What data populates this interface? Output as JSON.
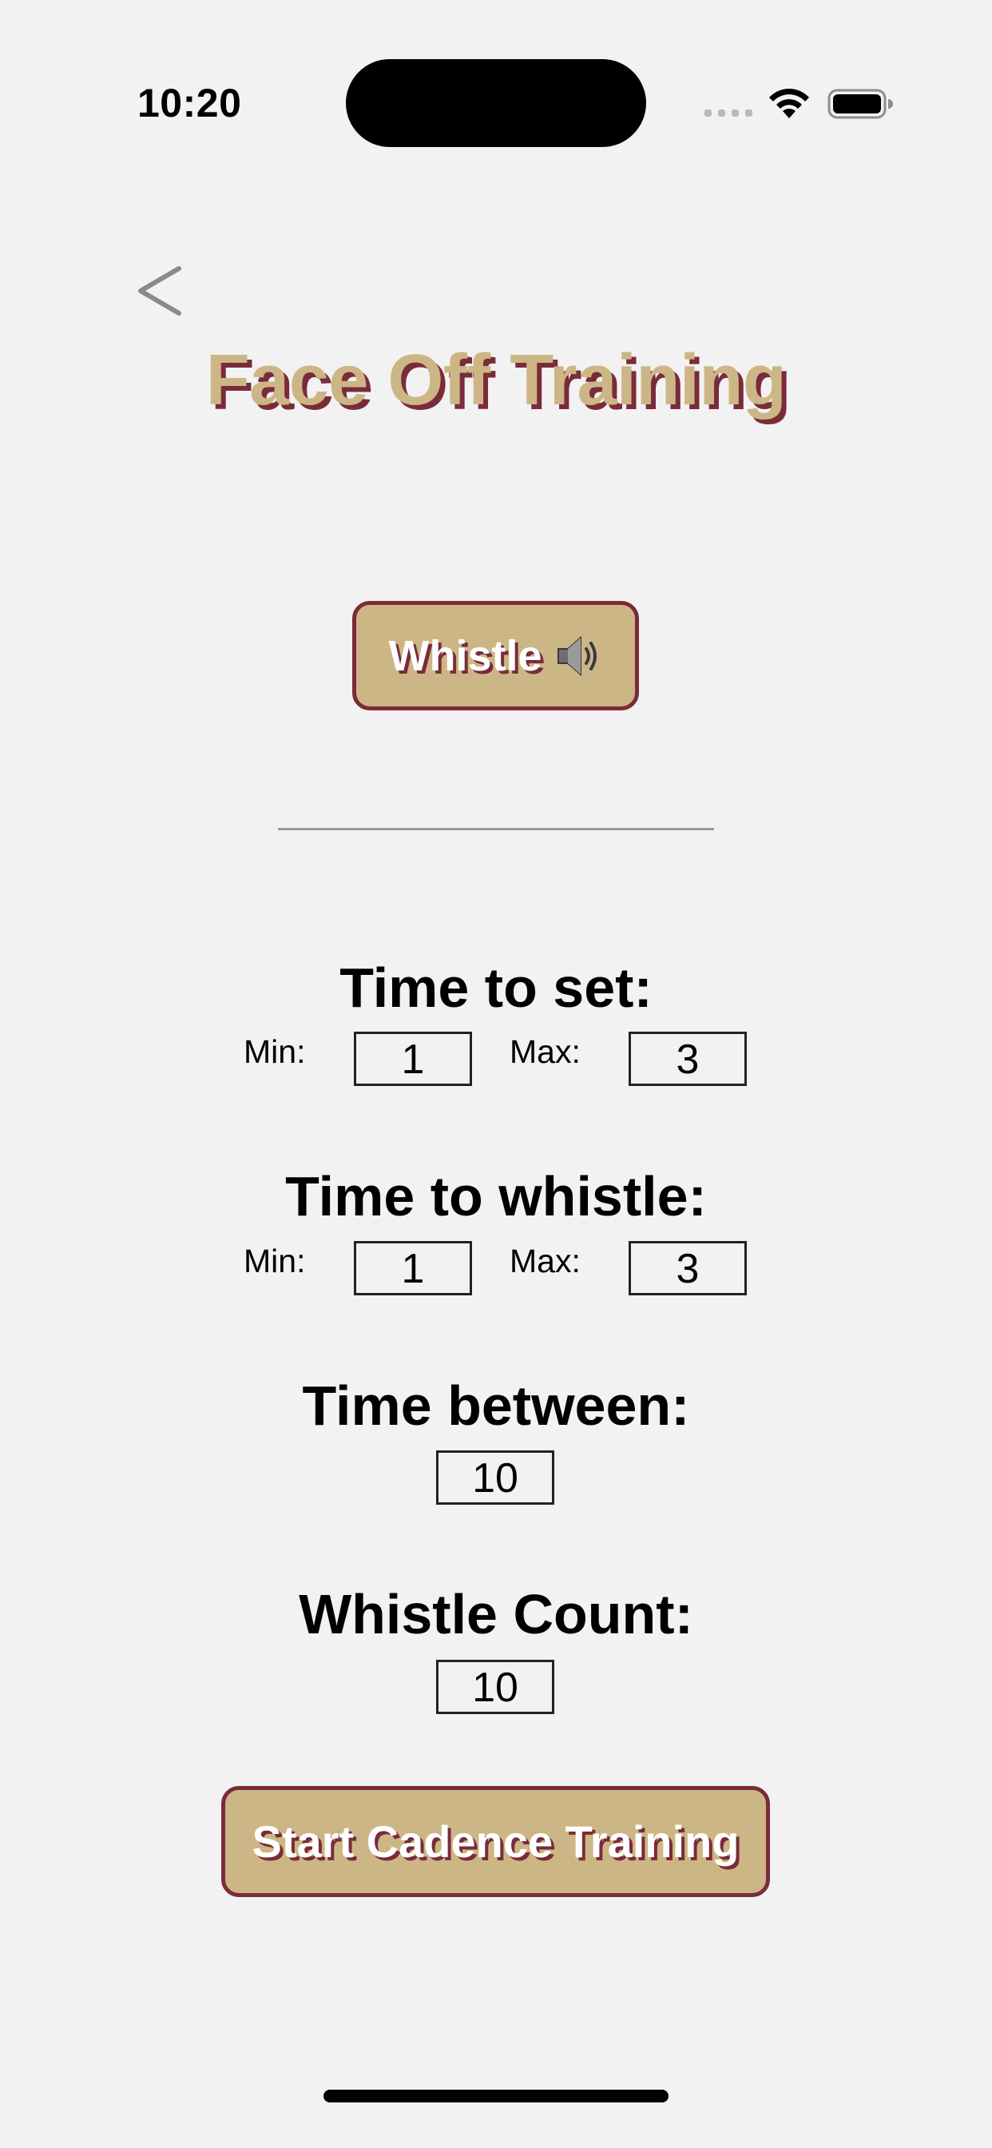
{
  "status_bar": {
    "time": "10:20",
    "icons": [
      "cellular-signal-icon",
      "wifi-icon",
      "battery-icon"
    ]
  },
  "nav": {
    "back_label": "<"
  },
  "title": "Face Off Training",
  "whistle_button": {
    "label": "Whistle",
    "icon": "speaker-icon"
  },
  "time_to_set": {
    "title": "Time to set:",
    "min_label": "Min:",
    "min_value": "1",
    "max_label": "Max:",
    "max_value": "3"
  },
  "time_to_whistle": {
    "title": "Time to whistle:",
    "min_label": "Min:",
    "min_value": "1",
    "max_label": "Max:",
    "max_value": "3"
  },
  "time_between": {
    "title": "Time between:",
    "value": "10"
  },
  "whistle_count": {
    "title": "Whistle Count:",
    "value": "10"
  },
  "start_button": {
    "label": "Start Cadence Training"
  },
  "colors": {
    "gold": "#cdb685",
    "maroon": "#7a2b3a",
    "background": "#f2f2f2"
  }
}
